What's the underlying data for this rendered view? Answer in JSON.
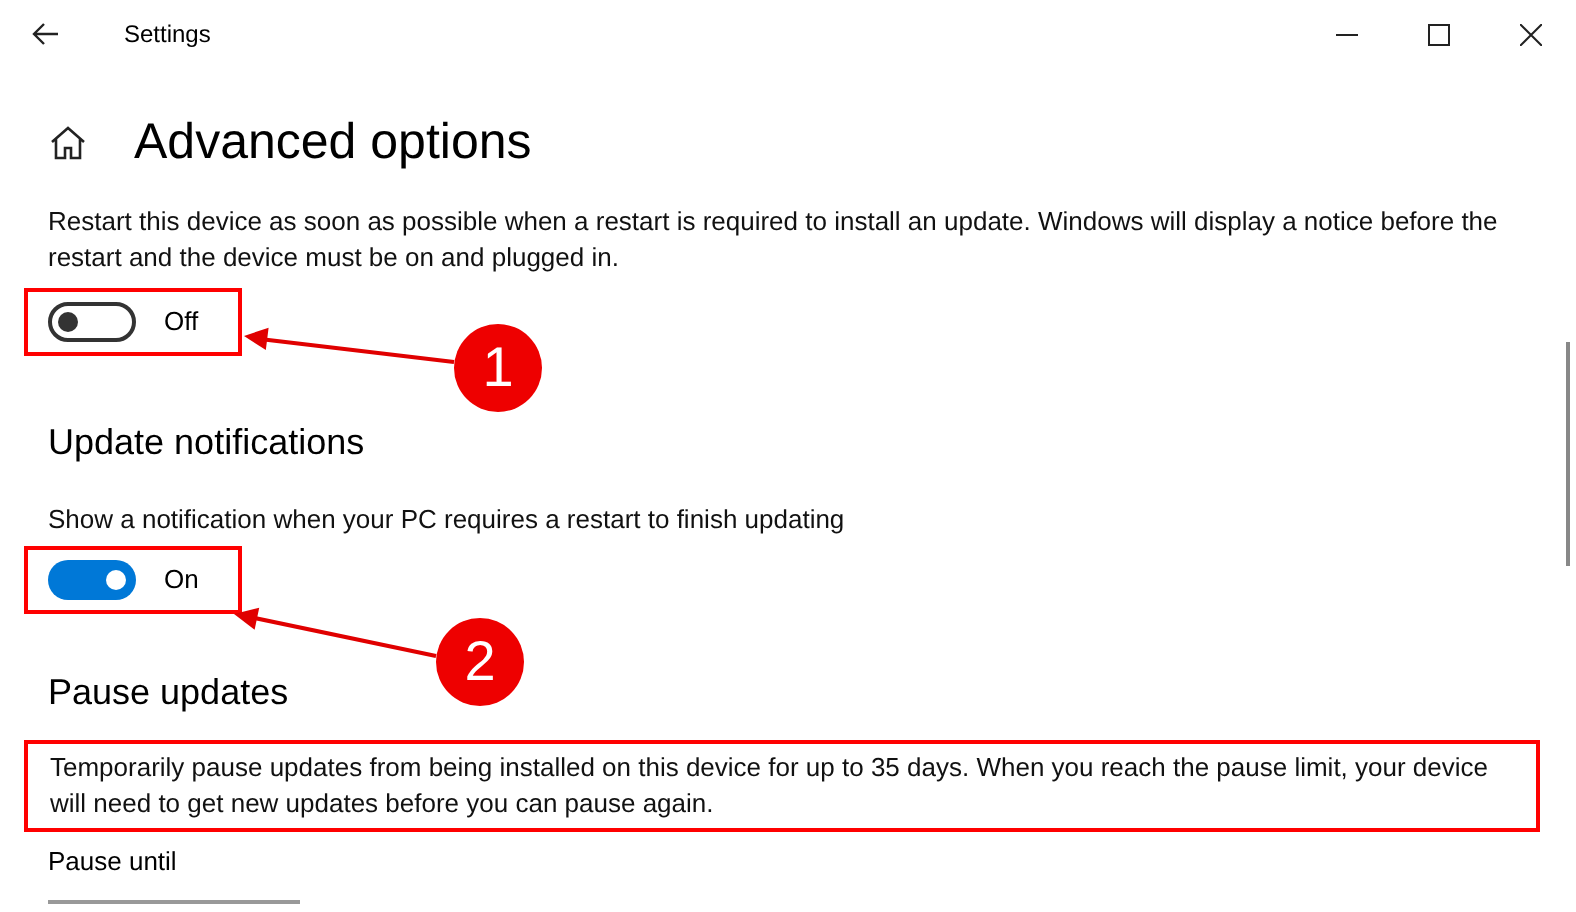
{
  "window": {
    "title": "Settings"
  },
  "page_title": "Advanced options",
  "restart_option": {
    "description": "Restart this device as soon as possible when a restart is required to install an update. Windows will display a notice before the restart and the device must be on and plugged in.",
    "toggle": {
      "on": false,
      "label": "Off",
      "highlighted": true
    }
  },
  "update_notifications": {
    "heading": "Update notifications",
    "description": "Show a notification when your PC requires a restart to finish updating",
    "toggle": {
      "on": true,
      "label": "On",
      "highlighted": true
    }
  },
  "pause_updates": {
    "heading": "Pause updates",
    "description": "Temporarily pause updates from being installed on this device for up to 35 days. When you reach the pause limit, your device will need to get new updates before you can pause again.",
    "description_highlighted": true,
    "pause_until_label": "Pause until"
  },
  "annotations": [
    {
      "number": "1"
    },
    {
      "number": "2"
    }
  ]
}
